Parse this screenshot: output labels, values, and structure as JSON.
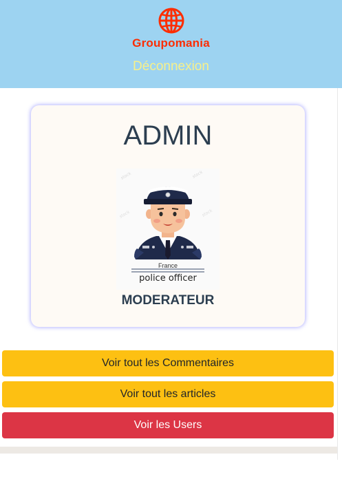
{
  "header": {
    "brand": "Groupomania",
    "logout_label": "Déconnexion",
    "background": "#9dd3f1",
    "brand_color": "#fd2d01",
    "logout_color": "#f7f08a"
  },
  "profile": {
    "title": "ADMIN",
    "avatar": {
      "icon": "police-officer-icon",
      "country": "France",
      "caption": "police officer"
    },
    "role": "MODERATEUR"
  },
  "actions": {
    "comments_label": "Voir tout les Commentaires",
    "articles_label": "Voir tout les articles",
    "users_label": "Voir les Users",
    "yellow": "#fdc012",
    "red": "#dc3545"
  }
}
